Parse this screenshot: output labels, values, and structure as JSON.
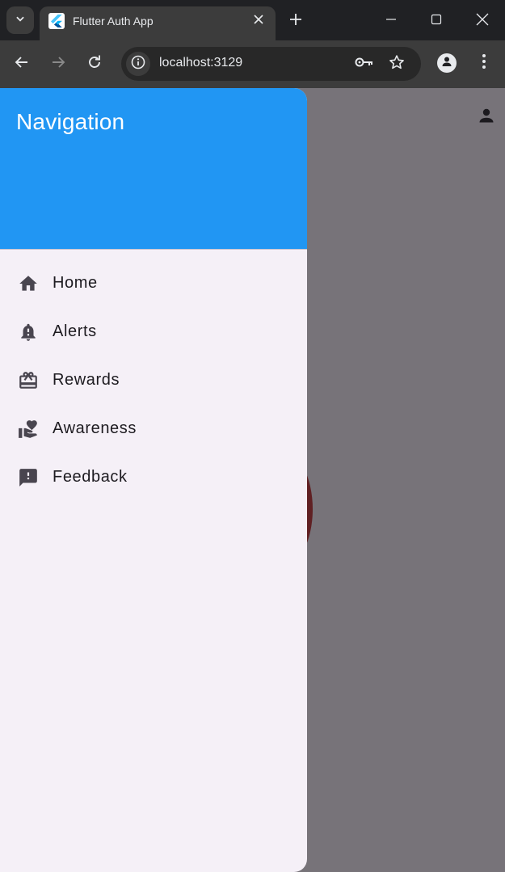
{
  "browser": {
    "tab_title": "Flutter Auth App",
    "url": "localhost:3129",
    "icons": {
      "tab_search": "chevron-down-icon",
      "favicon": "flutter-logo-icon",
      "tab_close": "close-icon",
      "new_tab": "plus-icon",
      "minimize": "minimize-icon",
      "maximize": "maximize-icon",
      "close_window": "close-icon",
      "back": "arrow-left-icon",
      "forward": "arrow-right-icon",
      "reload": "reload-icon",
      "site_info": "info-icon",
      "password": "key-icon",
      "bookmark": "star-icon",
      "profile": "person-icon",
      "menu": "more-vert-icon"
    },
    "colors": {
      "tabstrip": "#202124",
      "toolbar": "#3c3c3c",
      "omnibox": "#282828",
      "text": "#e8eaed"
    }
  },
  "app": {
    "account_icon": "person-icon",
    "drawer": {
      "header_title": "Navigation",
      "items": [
        {
          "label": "Home",
          "icon": "home-icon"
        },
        {
          "label": "Alerts",
          "icon": "bell-alert-icon"
        },
        {
          "label": "Rewards",
          "icon": "gift-card-icon"
        },
        {
          "label": "Awareness",
          "icon": "volunteer-heart-icon"
        },
        {
          "label": "Feedback",
          "icon": "feedback-icon"
        }
      ]
    },
    "colors": {
      "header": "#2196f3",
      "drawer_bg": "#f5f0f7",
      "scrim": "#787378",
      "accent_red": "#c62828",
      "label_text": "#1d1b20",
      "icon": "#49454f"
    }
  }
}
